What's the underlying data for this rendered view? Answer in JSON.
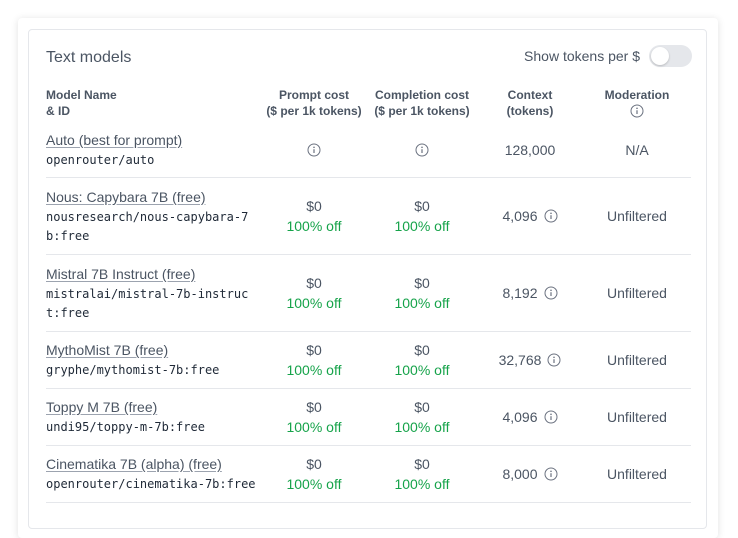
{
  "card": {
    "title": "Text models",
    "toggle_label": "Show tokens per $",
    "toggle_on": false
  },
  "header": {
    "name_line1": "Model Name",
    "name_line2": "& ID",
    "prompt_line1": "Prompt cost",
    "prompt_line2": "($ per 1k tokens)",
    "completion_line1": "Completion cost",
    "completion_line2": "($ per 1k tokens)",
    "context_line1": "Context",
    "context_line2": "(tokens)",
    "moderation": "Moderation",
    "moderation_icon": "info-icon"
  },
  "models": [
    {
      "name": "Auto (best for prompt)",
      "id": "openrouter/auto",
      "prompt_icon": "info-icon",
      "completion_icon": "info-icon",
      "context": "128,000",
      "moderation": "N/A"
    },
    {
      "name": "Nous: Capybara 7B (free)",
      "id": "nousresearch/nous-capybara-7b:free",
      "prompt_price": "$0",
      "prompt_off": "100% off",
      "completion_price": "$0",
      "completion_off": "100% off",
      "context": "4,096",
      "context_icon": "info-icon",
      "moderation": "Unfiltered"
    },
    {
      "name": "Mistral 7B Instruct (free)",
      "id": "mistralai/mistral-7b-instruct:free",
      "prompt_price": "$0",
      "prompt_off": "100% off",
      "completion_price": "$0",
      "completion_off": "100% off",
      "context": "8,192",
      "context_icon": "info-icon",
      "moderation": "Unfiltered"
    },
    {
      "name": "MythoMist 7B (free)",
      "id": "gryphe/mythomist-7b:free",
      "prompt_price": "$0",
      "prompt_off": "100% off",
      "completion_price": "$0",
      "completion_off": "100% off",
      "context": "32,768",
      "context_icon": "info-icon",
      "moderation": "Unfiltered"
    },
    {
      "name": "Toppy M 7B (free)",
      "id": "undi95/toppy-m-7b:free",
      "prompt_price": "$0",
      "prompt_off": "100% off",
      "completion_price": "$0",
      "completion_off": "100% off",
      "context": "4,096",
      "context_icon": "info-icon",
      "moderation": "Unfiltered"
    },
    {
      "name": "Cinematika 7B (alpha) (free)",
      "id": "openrouter/cinematika-7b:free",
      "prompt_price": "$0",
      "prompt_off": "100% off",
      "completion_price": "$0",
      "completion_off": "100% off",
      "context": "8,000",
      "context_icon": "info-icon",
      "moderation": "Unfiltered"
    }
  ],
  "colors": {
    "text": "#4b5563",
    "id_text": "#1f2937",
    "discount": "#16a34a",
    "divider": "#e5e7eb",
    "toggle_track": "#e5e7eb"
  }
}
